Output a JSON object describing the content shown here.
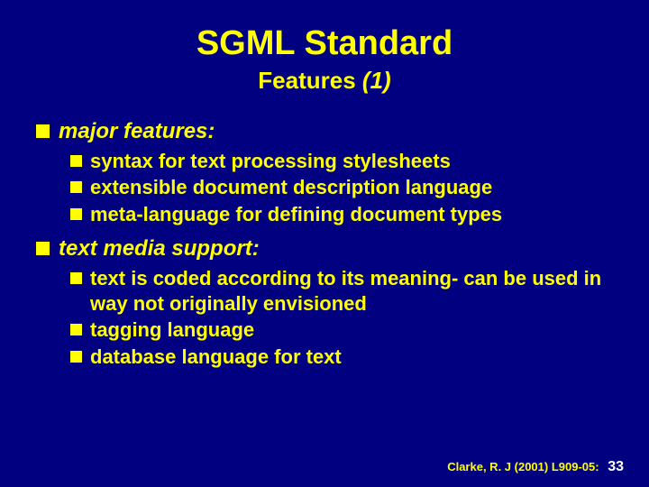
{
  "title": "SGML Standard",
  "subtitle_prefix": "Features ",
  "subtitle_paren": "(1)",
  "sections": {
    "s1": {
      "heading": "major features:",
      "items": [
        "syntax for text processing stylesheets",
        "extensible document description language",
        "meta-language for defining document types"
      ]
    },
    "s2": {
      "heading": "text media support:",
      "items": [
        "text is coded according to its meaning- can be used in way not originally envisioned",
        "tagging language",
        "database language for text"
      ]
    }
  },
  "footer": {
    "citation": "Clarke, R. J (2001) L909-05:",
    "page": "33"
  }
}
